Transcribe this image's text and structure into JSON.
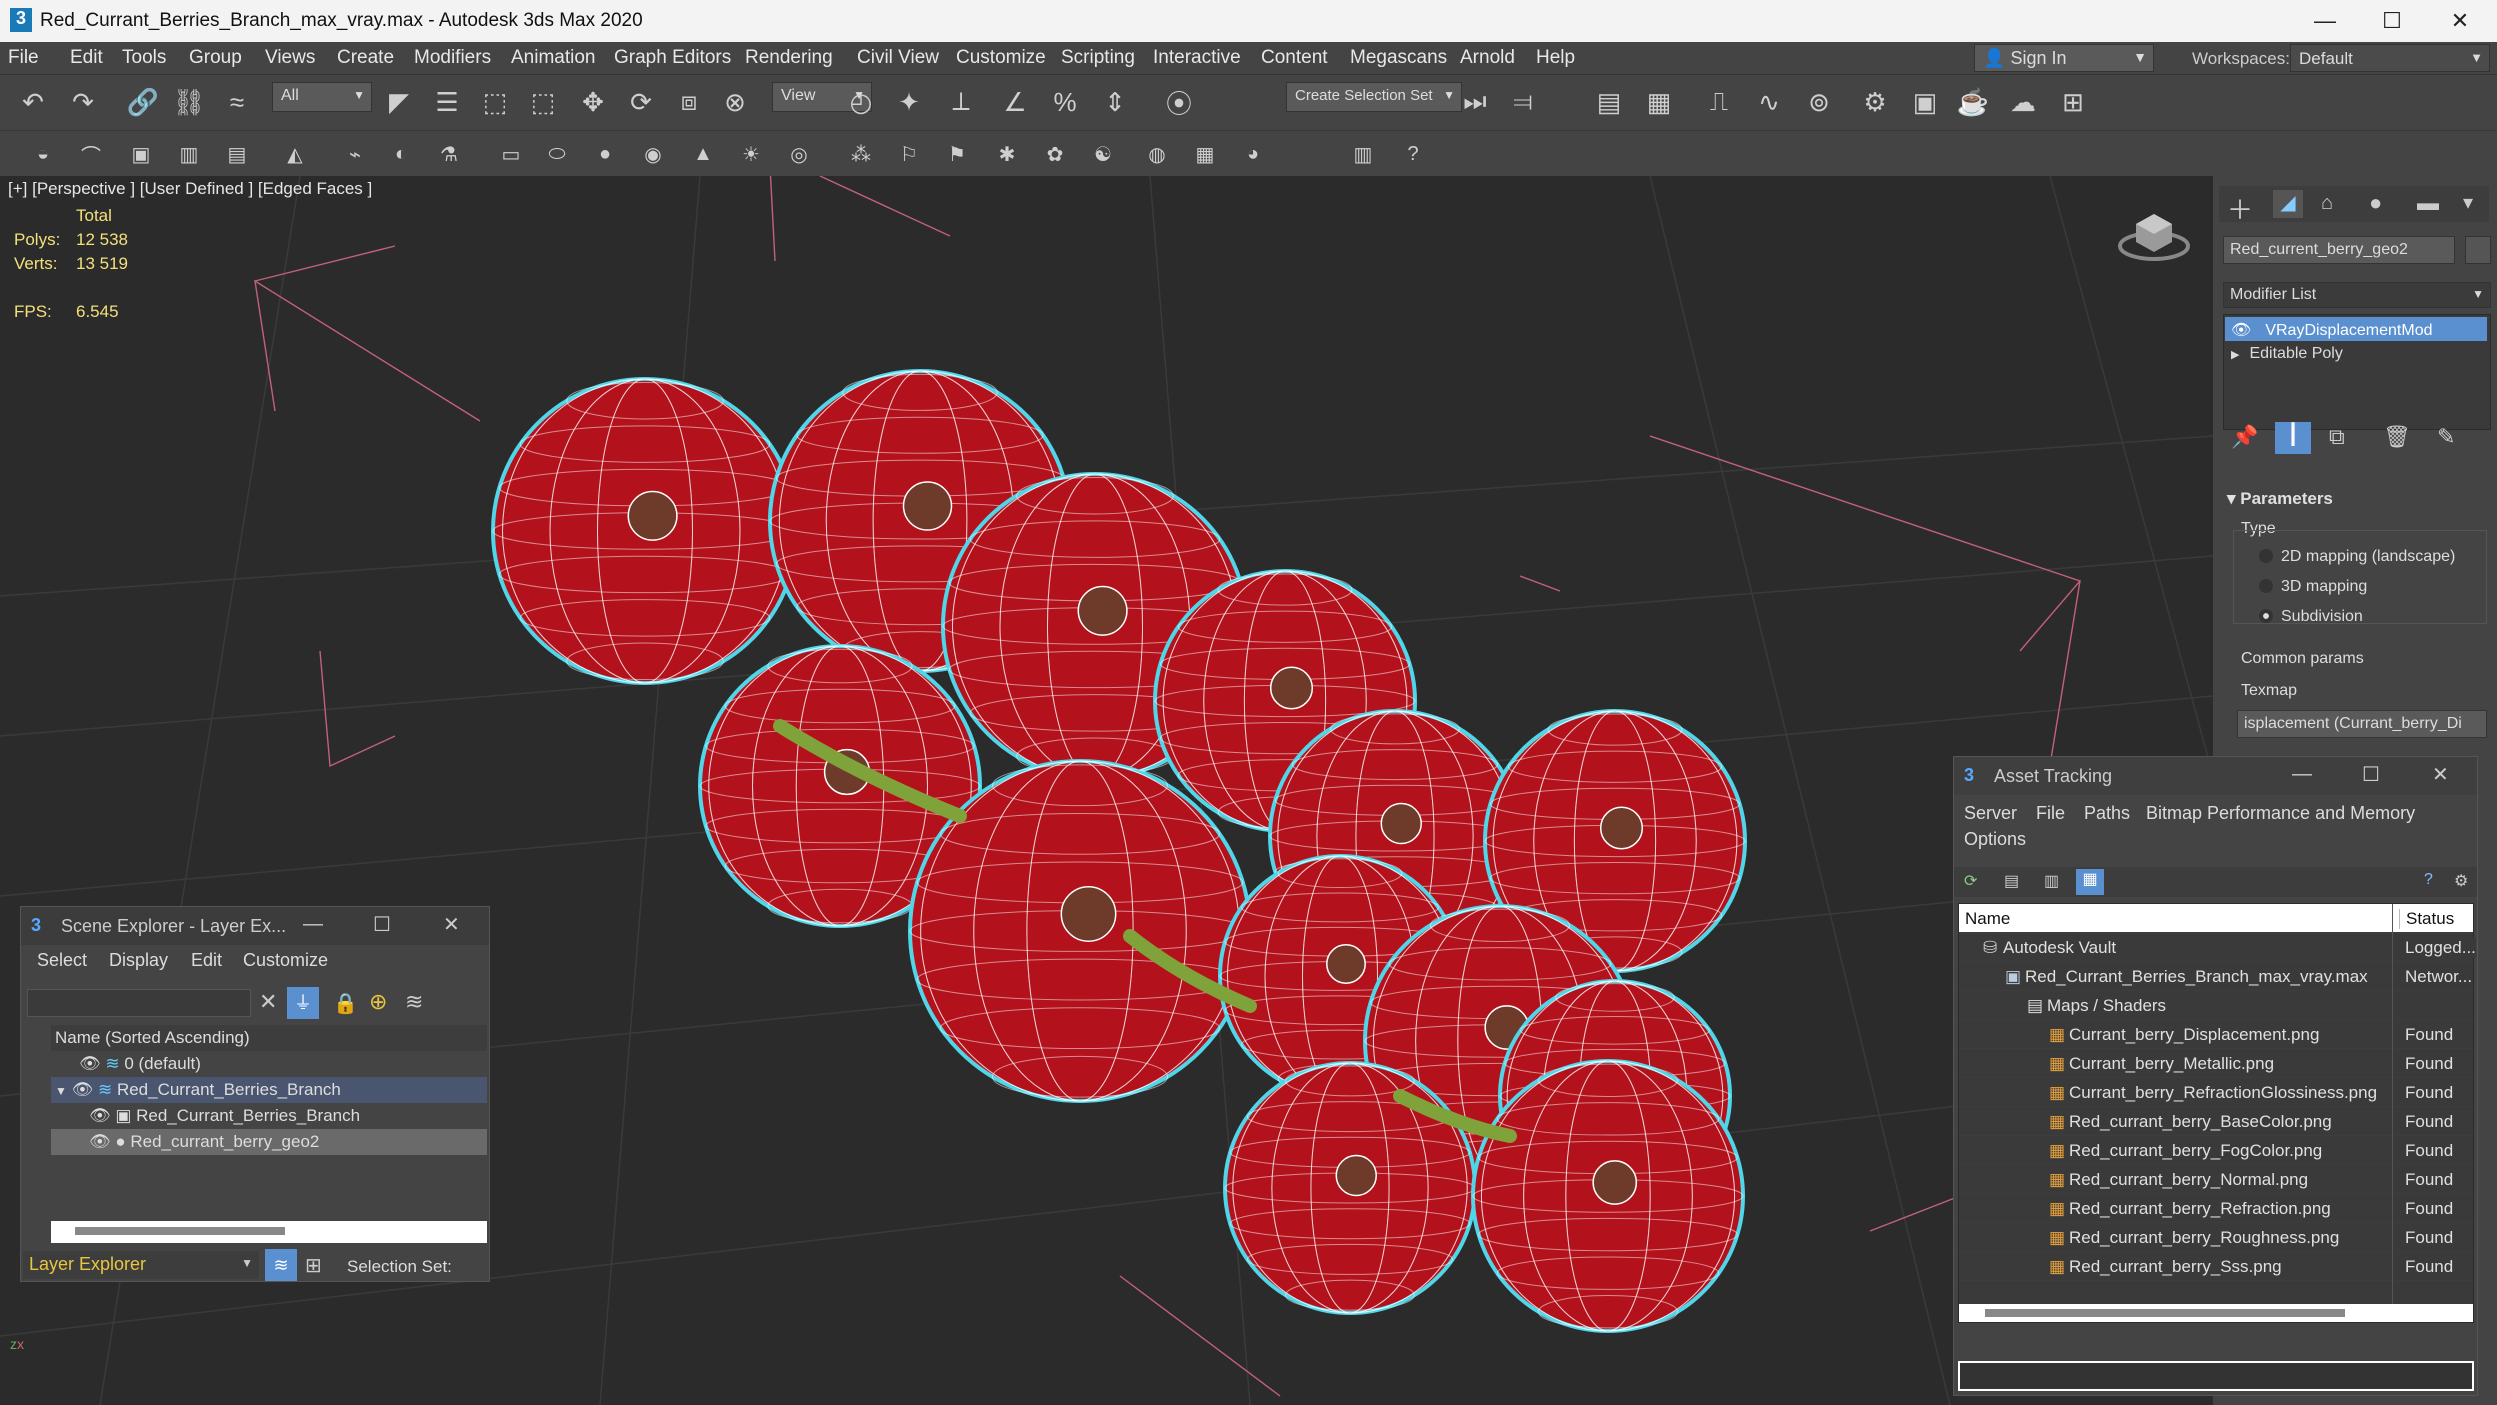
{
  "window": {
    "title": "Red_Currant_Berries_Branch_max_vray.max - Autodesk 3ds Max 2020",
    "minimize": "—",
    "maximize": "☐",
    "close": "✕"
  },
  "menu": [
    "File",
    "Edit",
    "Tools",
    "Group",
    "Views",
    "Create",
    "Modifiers",
    "Animation",
    "Graph Editors",
    "Rendering",
    "Civil View",
    "Customize",
    "Scripting",
    "Interactive",
    "Content",
    "Megascans",
    "Arnold",
    "Help"
  ],
  "account": {
    "sign_in": "Sign In",
    "workspaces_label": "Workspaces:",
    "workspace": "Default"
  },
  "toolbar": {
    "filter": "All",
    "ref_coord": "View",
    "selection_set": "Create Selection Set",
    "snap_label": "3",
    "icons": [
      "undo-icon",
      "redo-icon",
      "link-icon",
      "unlink-icon",
      "bind-spacewarp-icon",
      "select-object-icon",
      "select-by-name-icon",
      "rect-select-icon",
      "window-crossing-icon",
      "move-icon",
      "rotate-icon",
      "scale-icon",
      "placement-icon",
      "pivot-icon",
      "manipulate-icon",
      "snap-icon",
      "angle-snap-icon",
      "percent-snap-icon",
      "spinner-snap-icon",
      "named-sel-icon",
      "mirror-icon",
      "align-icon",
      "layer-icon",
      "ribbon-icon",
      "schematic-icon",
      "curve-editor-icon",
      "material-editor-icon",
      "render-setup-icon",
      "render-frame-icon",
      "render-icon",
      "render-cloud-icon",
      "a360-icon"
    ]
  },
  "viewport": {
    "label": "[+] [Perspective ] [User Defined ] [Edged Faces ]",
    "stats": {
      "total": "Total",
      "polys_label": "Polys:",
      "polys": "12 538",
      "verts_label": "Verts:",
      "verts": "13 519",
      "fps_label": "FPS:",
      "fps": "6.545"
    }
  },
  "command_panel": {
    "object_name": "Red_current_berry_geo2",
    "modifier_list": "Modifier List",
    "stack": [
      "VRayDisplacementMod",
      "Editable Poly"
    ],
    "rollout": "Parameters",
    "type_label": "Type",
    "types": [
      "2D mapping (landscape)",
      "3D mapping",
      "Subdivision"
    ],
    "selected_type": "Subdivision",
    "common": "Common params",
    "texmap": "Texmap",
    "texmap_value": "isplacement (Currant_berry_Di"
  },
  "scene_explorer": {
    "title": "Scene Explorer - Layer Ex...",
    "menu": [
      "Select",
      "Display",
      "Edit",
      "Customize"
    ],
    "column": "Name (Sorted Ascending)",
    "rows": [
      "0 (default)",
      "Red_Currant_Berries_Branch",
      "Red_Currant_Berries_Branch",
      "Red_currant_berry_geo2"
    ],
    "footer_mode": "Layer Explorer",
    "selection_set": "Selection Set:"
  },
  "asset_tracking": {
    "title": "Asset Tracking",
    "menu": [
      "Server",
      "File",
      "Paths",
      "Bitmap Performance and Memory",
      "Options"
    ],
    "col_name": "Name",
    "col_status": "Status",
    "rows": [
      {
        "name": "Autodesk Vault",
        "status": "Logged...",
        "indent": 0,
        "icon": "vault-icon"
      },
      {
        "name": "Red_Currant_Berries_Branch_max_vray.max",
        "status": "Networ...",
        "indent": 1,
        "icon": "max-file-icon"
      },
      {
        "name": "Maps / Shaders",
        "status": "",
        "indent": 2,
        "icon": "folder-icon"
      },
      {
        "name": "Currant_berry_Displacement.png",
        "status": "Found",
        "indent": 3,
        "icon": "bitmap-icon"
      },
      {
        "name": "Currant_berry_Metallic.png",
        "status": "Found",
        "indent": 3,
        "icon": "bitmap-icon"
      },
      {
        "name": "Currant_berry_RefractionGlossiness.png",
        "status": "Found",
        "indent": 3,
        "icon": "bitmap-icon"
      },
      {
        "name": "Red_currant_berry_BaseColor.png",
        "status": "Found",
        "indent": 3,
        "icon": "bitmap-icon"
      },
      {
        "name": "Red_currant_berry_FogColor.png",
        "status": "Found",
        "indent": 3,
        "icon": "bitmap-icon"
      },
      {
        "name": "Red_currant_berry_Normal.png",
        "status": "Found",
        "indent": 3,
        "icon": "bitmap-icon"
      },
      {
        "name": "Red_currant_berry_Refraction.png",
        "status": "Found",
        "indent": 3,
        "icon": "bitmap-icon"
      },
      {
        "name": "Red_currant_berry_Roughness.png",
        "status": "Found",
        "indent": 3,
        "icon": "bitmap-icon"
      },
      {
        "name": "Red_currant_berry_Sss.png",
        "status": "Found",
        "indent": 3,
        "icon": "bitmap-icon"
      }
    ]
  },
  "colors": {
    "accent": "#5a8fd0",
    "selection_outline": "#4fd6e8",
    "berry": "#b3121c",
    "stem": "#6f9a2a"
  }
}
